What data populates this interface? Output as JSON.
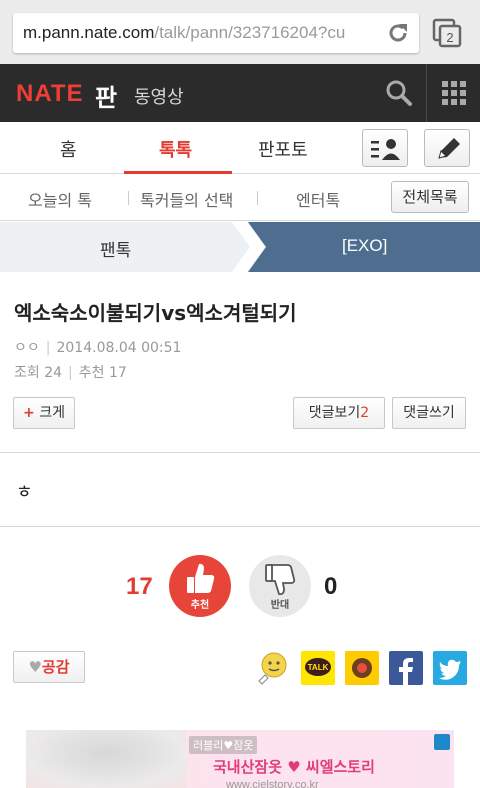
{
  "browser": {
    "url_host": "m.pann.nate.com",
    "url_path": "/talk/pann/323716204?cu",
    "tab_count": "2"
  },
  "header": {
    "logo": "NATE",
    "logo_pan": "판",
    "video": "동영상"
  },
  "main_nav": {
    "items": [
      "홈",
      "톡톡",
      "판포토"
    ],
    "active": "톡톡"
  },
  "sub_nav": {
    "items": [
      "오늘의 톡",
      "톡커들의 선택",
      "엔터톡"
    ],
    "all_list": "전체목록"
  },
  "breadcrumb": {
    "left": "팬톡",
    "right": "[EXO]"
  },
  "post": {
    "title": "엑소숙소이불되기vs엑소겨털되기",
    "author": "ㅇㅇ",
    "date": "2014.08.04 00:51",
    "views_label": "조회",
    "views": "24",
    "recommend_label": "추천",
    "recommend": "17",
    "content": "ㅎ"
  },
  "buttons": {
    "bigger_plus": "+",
    "bigger": "크게",
    "view_comments": "댓글보기",
    "comment_count": "2",
    "write_comment": "댓글쓰기"
  },
  "vote": {
    "up_count": "17",
    "up_label": "추천",
    "down_label": "반대",
    "down_count": "0"
  },
  "empathy": {
    "label": "공감"
  },
  "share": [
    "comment-icon",
    "kakaotalk-icon",
    "kakaostory-icon",
    "facebook-icon",
    "twitter-icon"
  ],
  "ad": {
    "small": "러블리♥잠옷",
    "main": "국내산잠옷 ♥ 씨엘스토리",
    "url": "www.cielstory.co.kr"
  },
  "colors": {
    "accent": "#e33b33",
    "header_bg": "#2b2b2b",
    "breadcrumb_blue": "#4f6d8e"
  }
}
